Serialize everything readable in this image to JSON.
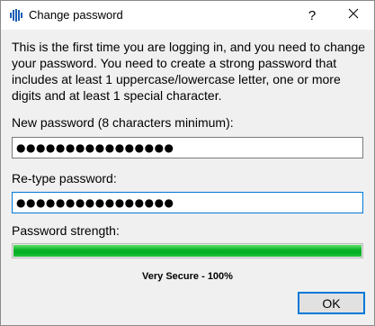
{
  "window": {
    "title": "Change password",
    "app_icon": "app-logo-icon",
    "help_label": "?",
    "close_icon": "close-icon"
  },
  "dialog": {
    "description": "This is the first time you are logging in, and you need to change your password. You need to create a strong password that includes at least 1 uppercase/lowercase letter, one or more digits and at least 1 special character.",
    "new_password_label": "New password (8 characters minimum):",
    "new_password_value": "●●●●●●●●●●●●●●●●",
    "retype_label": "Re-type password:",
    "retype_value": "●●●●●●●●●●●●●●●●",
    "strength_label": "Password strength:",
    "strength_percent": 100,
    "strength_text": "Very Secure - 100%",
    "ok_label": "OK"
  },
  "colors": {
    "accent": "#0078d7",
    "progress_green": "#06b025"
  }
}
